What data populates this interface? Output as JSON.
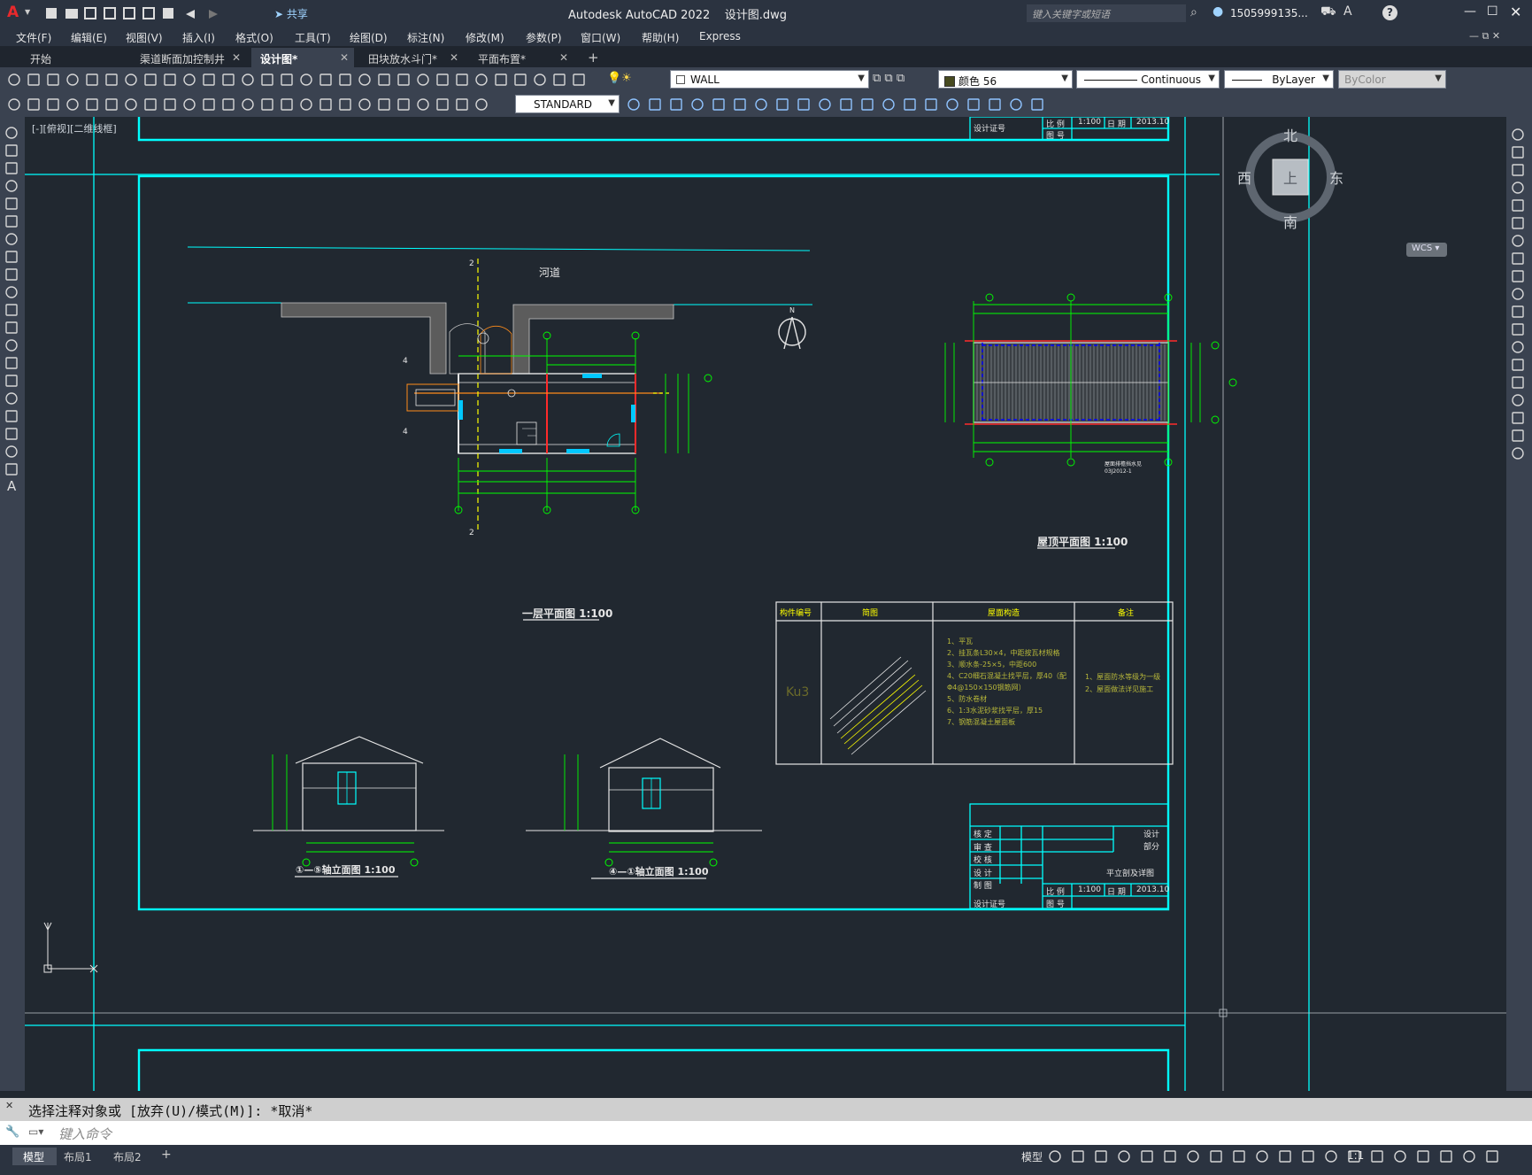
{
  "title_bar": {
    "app_title": "Autodesk AutoCAD 2022",
    "file_name": "设计图.dwg",
    "share_label": "共享",
    "search_placeholder": "键入关键字或短语",
    "user": "1505999135...",
    "help": "?"
  },
  "menu": [
    "文件(F)",
    "编辑(E)",
    "视图(V)",
    "插入(I)",
    "格式(O)",
    "工具(T)",
    "绘图(D)",
    "标注(N)",
    "修改(M)",
    "参数(P)",
    "窗口(W)",
    "帮助(H)",
    "Express"
  ],
  "tabs": [
    {
      "label": "开始",
      "active": false,
      "closable": false
    },
    {
      "label": "渠道断面加控制井",
      "active": false,
      "closable": true
    },
    {
      "label": "设计图*",
      "active": true,
      "closable": true
    },
    {
      "label": "田块放水斗门*",
      "active": false,
      "closable": true
    },
    {
      "label": "平面布置*",
      "active": false,
      "closable": true
    }
  ],
  "toolbar": {
    "layer": "WALL",
    "color": "颜色 56",
    "linetype": "Continuous",
    "lineweight": "ByLayer",
    "plotstyle": "ByColor",
    "textstyle": "STANDARD"
  },
  "viewport_label": "[-][俯视][二维线框]",
  "viewcube": {
    "north": "北",
    "south": "南",
    "east": "东",
    "west": "西",
    "top": "上",
    "wcs": "WCS"
  },
  "drawing": {
    "river_label": "河道",
    "plan_title": "一层平面图 1:100",
    "roof_title": "屋顶平面图 1:100",
    "elev1_title": "①—⑤轴立面图 1:100",
    "elev2_title": "④—①轴立面图 1:100",
    "table_headers": [
      "构件编号",
      "简图",
      "屋面构造",
      "备注"
    ],
    "table_id": "Ku3",
    "table_notes": [
      "1、平瓦",
      "2、挂瓦条L30×4，中距按瓦材规格",
      "3、顺水条-25×5，中距600",
      "4、C20细石混凝土找平层，厚40（配",
      "Φ4@150×150钢筋网）",
      "5、防水卷材",
      "6、1:3水泥砂浆找平层，厚15",
      "7、钢筋混凝土屋面板"
    ],
    "table_remarks": [
      "1、屋面防水等级为一级",
      "2、屋面做法详见施工"
    ],
    "title_block": {
      "rows": [
        "核 定",
        "审 查",
        "校 核",
        "设 计",
        "制 图",
        "设计证号"
      ],
      "right_top": [
        "设计",
        "部分"
      ],
      "drawing_name": "平立剖及详图",
      "scale_label": "比 例",
      "scale": "1:100",
      "date_label": "日 期",
      "date": "2013.10",
      "drawing_no_label": "图 号"
    },
    "top_block": {
      "scale_label": "比 例",
      "scale": "1:100",
      "date_label": "日 期",
      "date": "2013.10",
      "drawing_no_label": "图 号",
      "cert": "设计证号"
    },
    "roof_notes": [
      "屋面排檐挡水见",
      "03J2012-1"
    ]
  },
  "command": {
    "history": "选择注释对象或 [放弃(U)/模式(M)]: *取消*",
    "placeholder": "键入命令"
  },
  "status": {
    "tabs": [
      "模型",
      "布局1",
      "布局2"
    ],
    "model_label": "模型",
    "scale": "1:1"
  },
  "colors": {
    "frame": "#00ffff",
    "dim_green": "#00ff00",
    "axis_red": "#ff0000",
    "yellow": "#ffff00",
    "background": "#212830"
  }
}
